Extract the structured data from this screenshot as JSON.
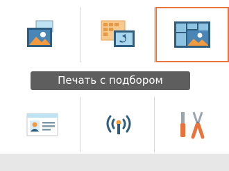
{
  "screen": {
    "menu": {
      "tiles": [
        {
          "icon": "photo-print-icon",
          "selected": false
        },
        {
          "icon": "photo-index-icon",
          "selected": false
        },
        {
          "icon": "layout-print-icon",
          "selected": true
        },
        {
          "icon": "id-photo-icon",
          "selected": false
        },
        {
          "icon": "wireless-icon",
          "selected": false
        },
        {
          "icon": "settings-tools-icon",
          "selected": false
        }
      ],
      "selected_label": "Печать с подбором"
    },
    "colors": {
      "accent": "#e8743b",
      "label_bg": "#5e5e5e",
      "divider": "#d5d5d5",
      "footer_bg": "#e7e7e7"
    }
  }
}
